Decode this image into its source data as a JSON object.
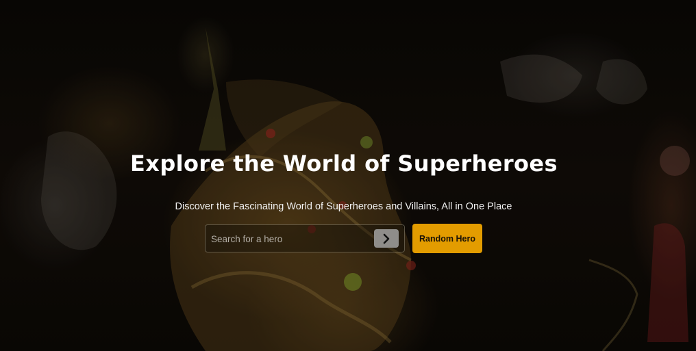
{
  "hero": {
    "title": "Explore the World of Superheroes",
    "subtitle": "Discover the Fascinating World of Superheroes and Villains, All in One Place"
  },
  "search": {
    "placeholder": "Search for a hero",
    "value": "",
    "submit_icon": "chevron-right-icon"
  },
  "actions": {
    "random_label": "Random Hero"
  },
  "colors": {
    "accent": "#e39c00",
    "search_button": "#8f8d8a",
    "text": "#ffffff"
  },
  "background": {
    "image": "dark ornate venetian carnival mask"
  }
}
